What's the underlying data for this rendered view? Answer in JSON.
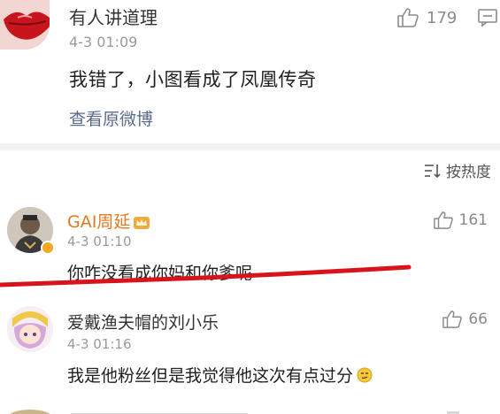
{
  "post": {
    "username": "有人讲道理",
    "time": "4-3 01:09",
    "text": "我错了，小图看成了凤凰传奇",
    "view_original": "查看原微博",
    "like_count": "179"
  },
  "sort": {
    "label": "按热度"
  },
  "comments": [
    {
      "username": "GAI周延",
      "time": "4-3 01:10",
      "text": "你咋没看成你妈和你爹呢",
      "like_count": "161"
    },
    {
      "username": "爱戴渔夫帽的刘小乐",
      "time": "4-3 01:16",
      "text": "我是他粉丝但是我觉得他这次有点过分",
      "like_count": "66"
    }
  ],
  "colors": {
    "accent_name": "#e07a1f",
    "link": "#5b6b8c",
    "annotation_red": "#d8131b"
  }
}
